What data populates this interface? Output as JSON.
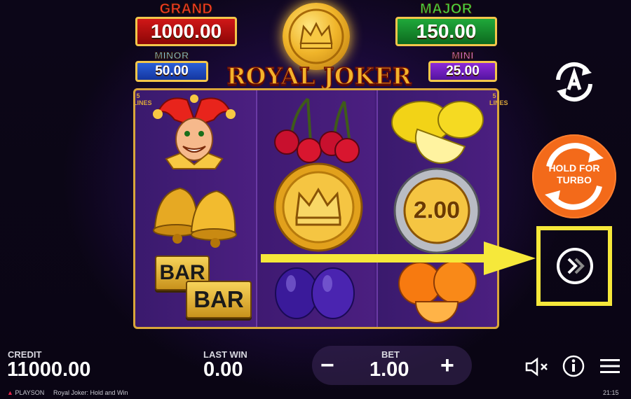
{
  "jackpots": {
    "grand": {
      "title": "GRAND",
      "value": "1000.00"
    },
    "major": {
      "title": "MAJOR",
      "value": "150.00"
    },
    "minor": {
      "title": "MINOR",
      "value": "50.00"
    },
    "mini": {
      "title": "MINI",
      "value": "25.00"
    }
  },
  "game_title": "ROYAL JOKER",
  "lines_label": "5 LINES",
  "reels": {
    "symbols": [
      [
        "joker",
        "bells",
        "bar"
      ],
      [
        "cherries",
        "crown-coin",
        "plums"
      ],
      [
        "lemons",
        "2.00",
        "oranges"
      ]
    ],
    "bar_text": "BAR",
    "coin_value": "2.00"
  },
  "controls": {
    "hold_for_turbo": "HOLD FOR TURBO",
    "autoplay_icon": "autoplay-A-icon",
    "turbo_icon": "fast-forward-icon"
  },
  "bottom": {
    "credit_label": "CREDIT",
    "credit_value": "11000.00",
    "last_win_label": "LAST WIN",
    "last_win_value": "0.00",
    "bet_label": "BET",
    "bet_value": "1.00",
    "minus": "−",
    "plus": "+"
  },
  "footer": {
    "brand": "PLAYSON",
    "game_name": "Royal Joker: Hold and Win",
    "time": "21:15"
  },
  "colors": {
    "highlight": "#f6e83a",
    "hold_button": "#f36a1a",
    "frame_gold": "#d9a63a"
  }
}
